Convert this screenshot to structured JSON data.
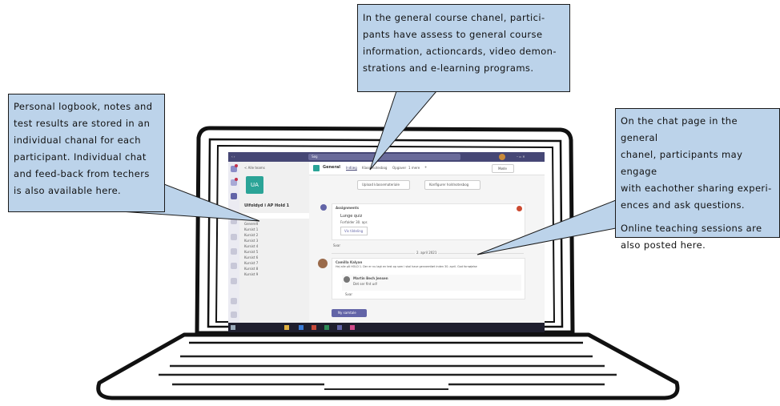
{
  "callouts": {
    "left": [
      "Personal logbook, notes and",
      "test results are stored in an",
      "individual chanal for each",
      "participant. Individual chat",
      "and feed-back from techers",
      "is also available here."
    ],
    "top": [
      "In the general course chanel, partici-",
      "pants have assess to general course",
      "information, actioncards, video demon-",
      "strations and e-learning programs."
    ],
    "right_a": [
      "On the chat page in the general",
      "chanel, participants may engage",
      "with eachother sharing experi-",
      "ences and ask questions."
    ],
    "right_b": [
      "Online teaching sessions are",
      "also posted here."
    ]
  },
  "screen": {
    "search": "Søg",
    "back_link": "< Alle teams",
    "team_avatar": "UA",
    "team_name": "Uifoldyd i AP Hold 1",
    "channels": [
      "Generelt",
      "Kursist 1",
      "Kursist 2",
      "Kursist 3",
      "Kursist 4",
      "Kursist 5",
      "Kursist 6",
      "Kursist 7",
      "Kursist 8",
      "Kursist 9"
    ],
    "channel_title": "General",
    "tabs": [
      "Indlæg",
      "Klassenotesbog",
      "Opgaver",
      "1 mere"
    ],
    "meet_button": "Møde",
    "pinned_buttons": [
      "Upload klassemateriale",
      "Konfigurer holdnotesbog"
    ],
    "post1_author": "Assignments",
    "post1_title": "Lunge quiz",
    "post1_sub": "Forfalder 30. apr.",
    "post1_action": "Vis tildeling",
    "reply_link": "Svar",
    "date_divider": "2. april 2021",
    "post2_author": "Camilla Kalyan",
    "post2_text": "Hej alle på HOLD 1. Der er nu lagt en test op som i skal have gennemført inden 30. april. God fornøjelse",
    "reply_author": "Martin Bech Jensen",
    "reply_text": "Det ser fint ud!",
    "new_post_button": "Ny samtale"
  },
  "colors": {
    "callout_fill": "#bcd3ea",
    "teams_purple": "#464775",
    "accent": "#6264a7"
  }
}
